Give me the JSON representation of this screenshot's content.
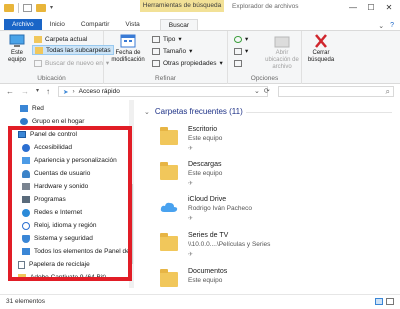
{
  "window": {
    "contextual_header": "Herramientas de búsqueda",
    "title": "Explorador de archivos",
    "controls": [
      "—",
      "☐",
      "✕"
    ]
  },
  "tabs": {
    "file": "Archivo",
    "home": "Inicio",
    "share": "Compartir",
    "view": "Vista",
    "search": "Buscar",
    "help": "?"
  },
  "ribbon": {
    "this_pc": "Este equipo",
    "current_folder": "Carpeta actual",
    "all_subfolders": "Todas las subcarpetas",
    "search_again_in": "Buscar de nuevo en",
    "location_label": "Ubicación",
    "modified_date": "Fecha de modificación",
    "type": "Tipo",
    "size": "Tamaño",
    "other_properties": "Otras propiedades",
    "refine_label": "Refinar",
    "open_location": "Abrir ubicación de archivo",
    "options_label": "Opciones",
    "close_search": "Cerrar búsqueda"
  },
  "address": {
    "path": "Acceso rápido"
  },
  "nav": {
    "items": [
      {
        "label": "Red"
      },
      {
        "label": "Grupo en el hogar"
      },
      {
        "label": "Panel de control"
      },
      {
        "label": "Accesibilidad"
      },
      {
        "label": "Apariencia y personalización"
      },
      {
        "label": "Cuentas de usuario"
      },
      {
        "label": "Hardware y sonido"
      },
      {
        "label": "Programas"
      },
      {
        "label": "Redes e Internet"
      },
      {
        "label": "Reloj, idioma y región"
      },
      {
        "label": "Sistema y seguridad"
      },
      {
        "label": "Todos los elementos de Panel de"
      },
      {
        "label": "Papelera de reciclaje"
      },
      {
        "label": "Adobe Captivate 9 (64 Bit)"
      }
    ]
  },
  "content": {
    "section_title": "Carpetas frecuentes (11)",
    "folders": [
      {
        "name": "Escritorio",
        "location": "Este equipo"
      },
      {
        "name": "Descargas",
        "location": "Este equipo"
      },
      {
        "name": "iCloud Drive",
        "location": "Rodrigo Iván Pacheco"
      },
      {
        "name": "Series de TV",
        "location": "\\\\10.0.0....\\Películas y Series"
      },
      {
        "name": "Documentos",
        "location": "Este equipo"
      }
    ]
  },
  "status": {
    "count": "31 elementos"
  },
  "colors": {
    "file_tab": "#1a65c7",
    "contextual": "#f2e197",
    "highlight": "#e11d26",
    "folder": "#f1c75b",
    "section": "#1e3287"
  }
}
